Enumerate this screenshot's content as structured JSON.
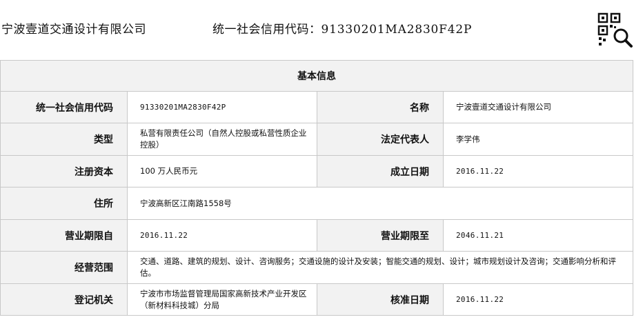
{
  "header": {
    "company_name": "宁波壹道交通设计有限公司",
    "credit_label": "统一社会信用代码：",
    "credit_code": "91330201MA2830F42P",
    "qr_icon": "qr-code-search-icon"
  },
  "table": {
    "caption": "基本信息",
    "rows": [
      {
        "label_1": "统一社会信用代码",
        "value_1": "91330201MA2830F42P",
        "label_2": "名称",
        "value_2": "宁波壹道交通设计有限公司"
      },
      {
        "label_1": "类型",
        "value_1": "私营有限责任公司（自然人控股或私营性质企业控股）",
        "label_2": "法定代表人",
        "value_2": "李学伟"
      },
      {
        "label_1": "注册资本",
        "value_1": "100 万人民币元",
        "label_2": "成立日期",
        "value_2": "2016.11.22"
      },
      {
        "label_1": "住所",
        "value_1": "宁波高新区江南路1558号"
      },
      {
        "label_1": "营业期限自",
        "value_1": "2016.11.22",
        "label_2": "营业期限至",
        "value_2": "2046.11.21"
      },
      {
        "label_1": "经营范围",
        "value_1": "交通、道路、建筑的规划、设计、咨询服务；交通设施的设计及安装；智能交通的规划、设计；城市规划设计及咨询；交通影响分析和评估。"
      },
      {
        "label_1": "登记机关",
        "value_1": "宁波市市场监督管理局国家高新技术产业开发区（新材料科技城）分局",
        "label_2": "核准日期",
        "value_2": "2016.11.22"
      }
    ]
  }
}
